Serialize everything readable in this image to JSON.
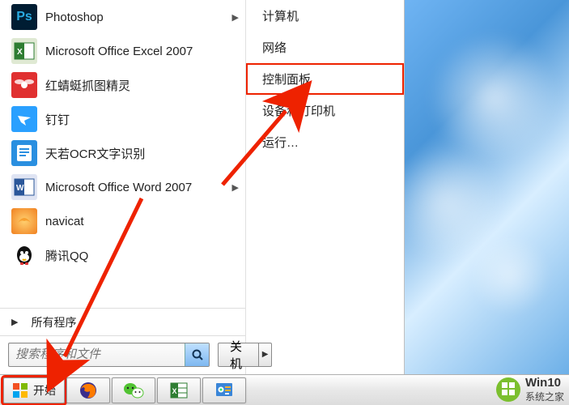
{
  "startMenu": {
    "programs": [
      {
        "label": "Photoshop",
        "hasSubmenu": true,
        "icon": "ps"
      },
      {
        "label": "Microsoft Office Excel 2007",
        "hasSubmenu": false,
        "icon": "excel"
      },
      {
        "label": "红蜻蜓抓图精灵",
        "hasSubmenu": false,
        "icon": "dragonfly"
      },
      {
        "label": "钉钉",
        "hasSubmenu": false,
        "icon": "dingtalk"
      },
      {
        "label": "天若OCR文字识别",
        "hasSubmenu": false,
        "icon": "ocr"
      },
      {
        "label": "Microsoft Office Word 2007",
        "hasSubmenu": true,
        "icon": "word"
      },
      {
        "label": "navicat",
        "hasSubmenu": false,
        "icon": "navicat"
      },
      {
        "label": "腾讯QQ",
        "hasSubmenu": false,
        "icon": "qq"
      }
    ],
    "allPrograms": "所有程序",
    "searchPlaceholder": "搜索程序和文件",
    "shutdown": "关机",
    "rightItems": [
      {
        "label": "计算机",
        "highlight": false
      },
      {
        "label": "网络",
        "highlight": false
      },
      {
        "label": "控制面板",
        "highlight": true
      },
      {
        "label": "设备和打印机",
        "highlight": false
      },
      {
        "label": "运行…",
        "highlight": false
      }
    ]
  },
  "taskbar": {
    "startLabel": "开始"
  },
  "watermark": {
    "badge": "10",
    "line1": "Win10",
    "line2": "系统之家"
  }
}
